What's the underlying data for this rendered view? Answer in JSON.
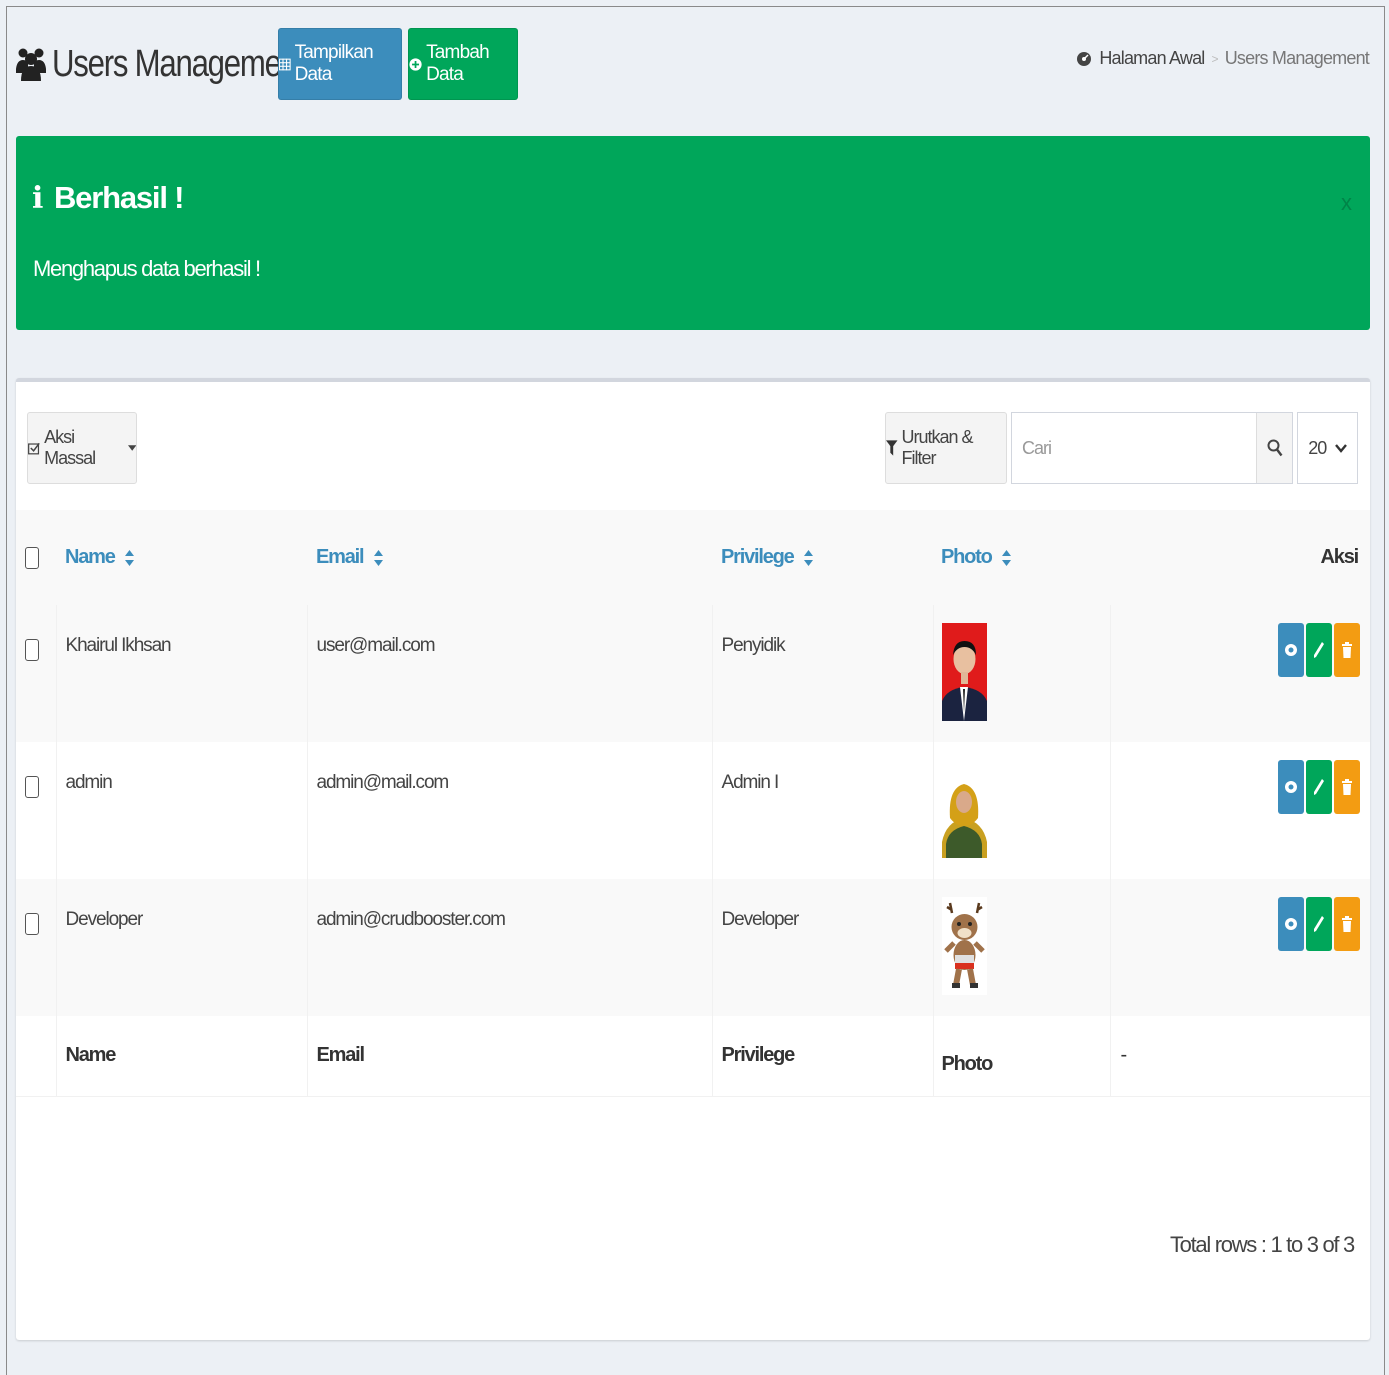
{
  "header": {
    "title": "Users Management",
    "show_button": "Tampilkan Data",
    "add_button": "Tambah Data",
    "breadcrumb": [
      "Halaman Awal",
      "Users Management"
    ]
  },
  "alert": {
    "title": "Berhasil !",
    "message": "Menghapus data berhasil !",
    "close": "x",
    "color": "#00a65a"
  },
  "toolbar": {
    "mass_action": "Aksi Massal",
    "filter": "Urutkan & Filter",
    "search_placeholder": "Cari",
    "limit": "20"
  },
  "table": {
    "columns": [
      "Name",
      "Email",
      "Privilege",
      "Photo",
      "Aksi"
    ],
    "rows": [
      {
        "name": "Khairul Ikhsan",
        "email": "user@mail.com",
        "privilege": "Penyidik",
        "photo": "formal-portrait-red-background"
      },
      {
        "name": "admin",
        "email": "admin@mail.com",
        "privilege": "Admin I",
        "photo": "woman-yellow-hijab"
      },
      {
        "name": "Developer",
        "email": "admin@crudbooster.com",
        "privilege": "Developer",
        "photo": "deer-mascot"
      }
    ],
    "footer": [
      "Name",
      "Email",
      "Privilege",
      "Photo",
      "-"
    ]
  },
  "pagination": {
    "total_rows": "Total rows : 1 to 3 of 3"
  },
  "colors": {
    "primary": "#3c8dbc",
    "success": "#00a65a",
    "warning": "#f39c12",
    "background": "#ecf0f5"
  }
}
